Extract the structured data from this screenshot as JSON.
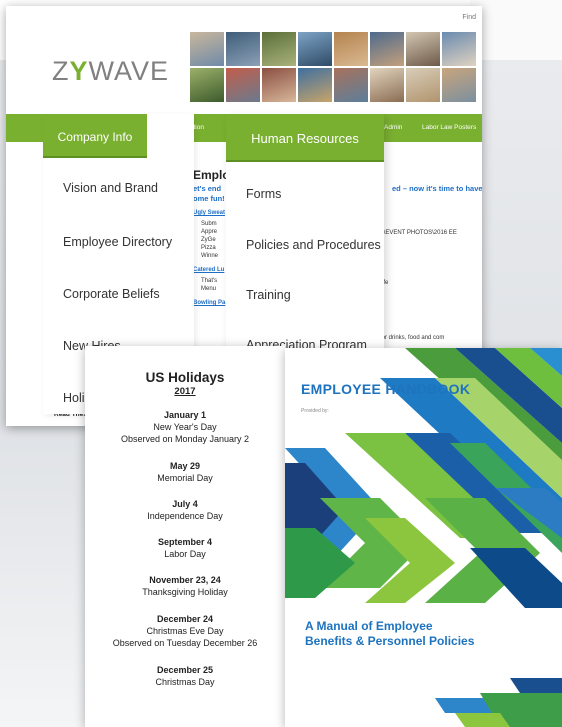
{
  "intranet": {
    "find_label": "Find",
    "logo_text_left": "Z",
    "logo_chevron": "Y",
    "logo_text_right": "WAVE",
    "nav": {
      "my_information": "My Information",
      "admin": "Admin",
      "labor_law_posters": "Labor Law Posters"
    },
    "company_menu": {
      "header": "Company Info",
      "items": [
        "Vision and Brand",
        "Employee Directory",
        "Corporate Beliefs",
        "New Hires",
        "Holi"
      ]
    },
    "hr_menu": {
      "header": "Human Resources",
      "items": [
        "Forms",
        "Policies and Procedures",
        "Training",
        "Appreciation Program"
      ]
    },
    "content": {
      "title": "Employ",
      "subhead_line1": "et's end",
      "subhead_line1_tail": "ed – now it's time to have",
      "subhead_line2": "ome fun!",
      "link_ugly": "Ugly Sweat",
      "bullets_ugly": [
        "Subm",
        "Appre",
        "ZyGe",
        "Pizza",
        "Winne"
      ],
      "path_text": "red\\EVENT PHOTOS\\2016 EE",
      "link_catered": "Catered Lu",
      "bullets_catered": [
        "That's",
        "Menu"
      ],
      "cafe_tail": "afe",
      "link_bowling": "Bowling Pa",
      "drinks_tail": "for drinks, food and com",
      "read_these": "Read Thes"
    }
  },
  "holidays": {
    "title": "US Holidays",
    "year": "2017",
    "entries": [
      {
        "date": "January 1",
        "lines": [
          "New Year's Day",
          "Observed on Monday January 2"
        ]
      },
      {
        "date": "May 29",
        "lines": [
          "Memorial Day"
        ]
      },
      {
        "date": "July 4",
        "lines": [
          "Independence Day"
        ]
      },
      {
        "date": "September 4",
        "lines": [
          "Labor Day"
        ]
      },
      {
        "date": "November 23, 24",
        "lines": [
          "Thanksgiving Holiday"
        ]
      },
      {
        "date": "December 24",
        "lines": [
          "Christmas Eve Day",
          "Observed on Tuesday December 26"
        ]
      },
      {
        "date": "December 25",
        "lines": [
          "Christmas Day"
        ]
      }
    ]
  },
  "handbook": {
    "title": "EMPLOYEE HANDBOOK",
    "provided_by": "Provided by:",
    "subtitle_line1": "A Manual of Employee",
    "subtitle_line2": "Benefits & Personnel Policies"
  },
  "colors": {
    "brand_green": "#7ab030",
    "link_blue": "#1d6ec7",
    "handbook_blue": "#1e73be"
  }
}
